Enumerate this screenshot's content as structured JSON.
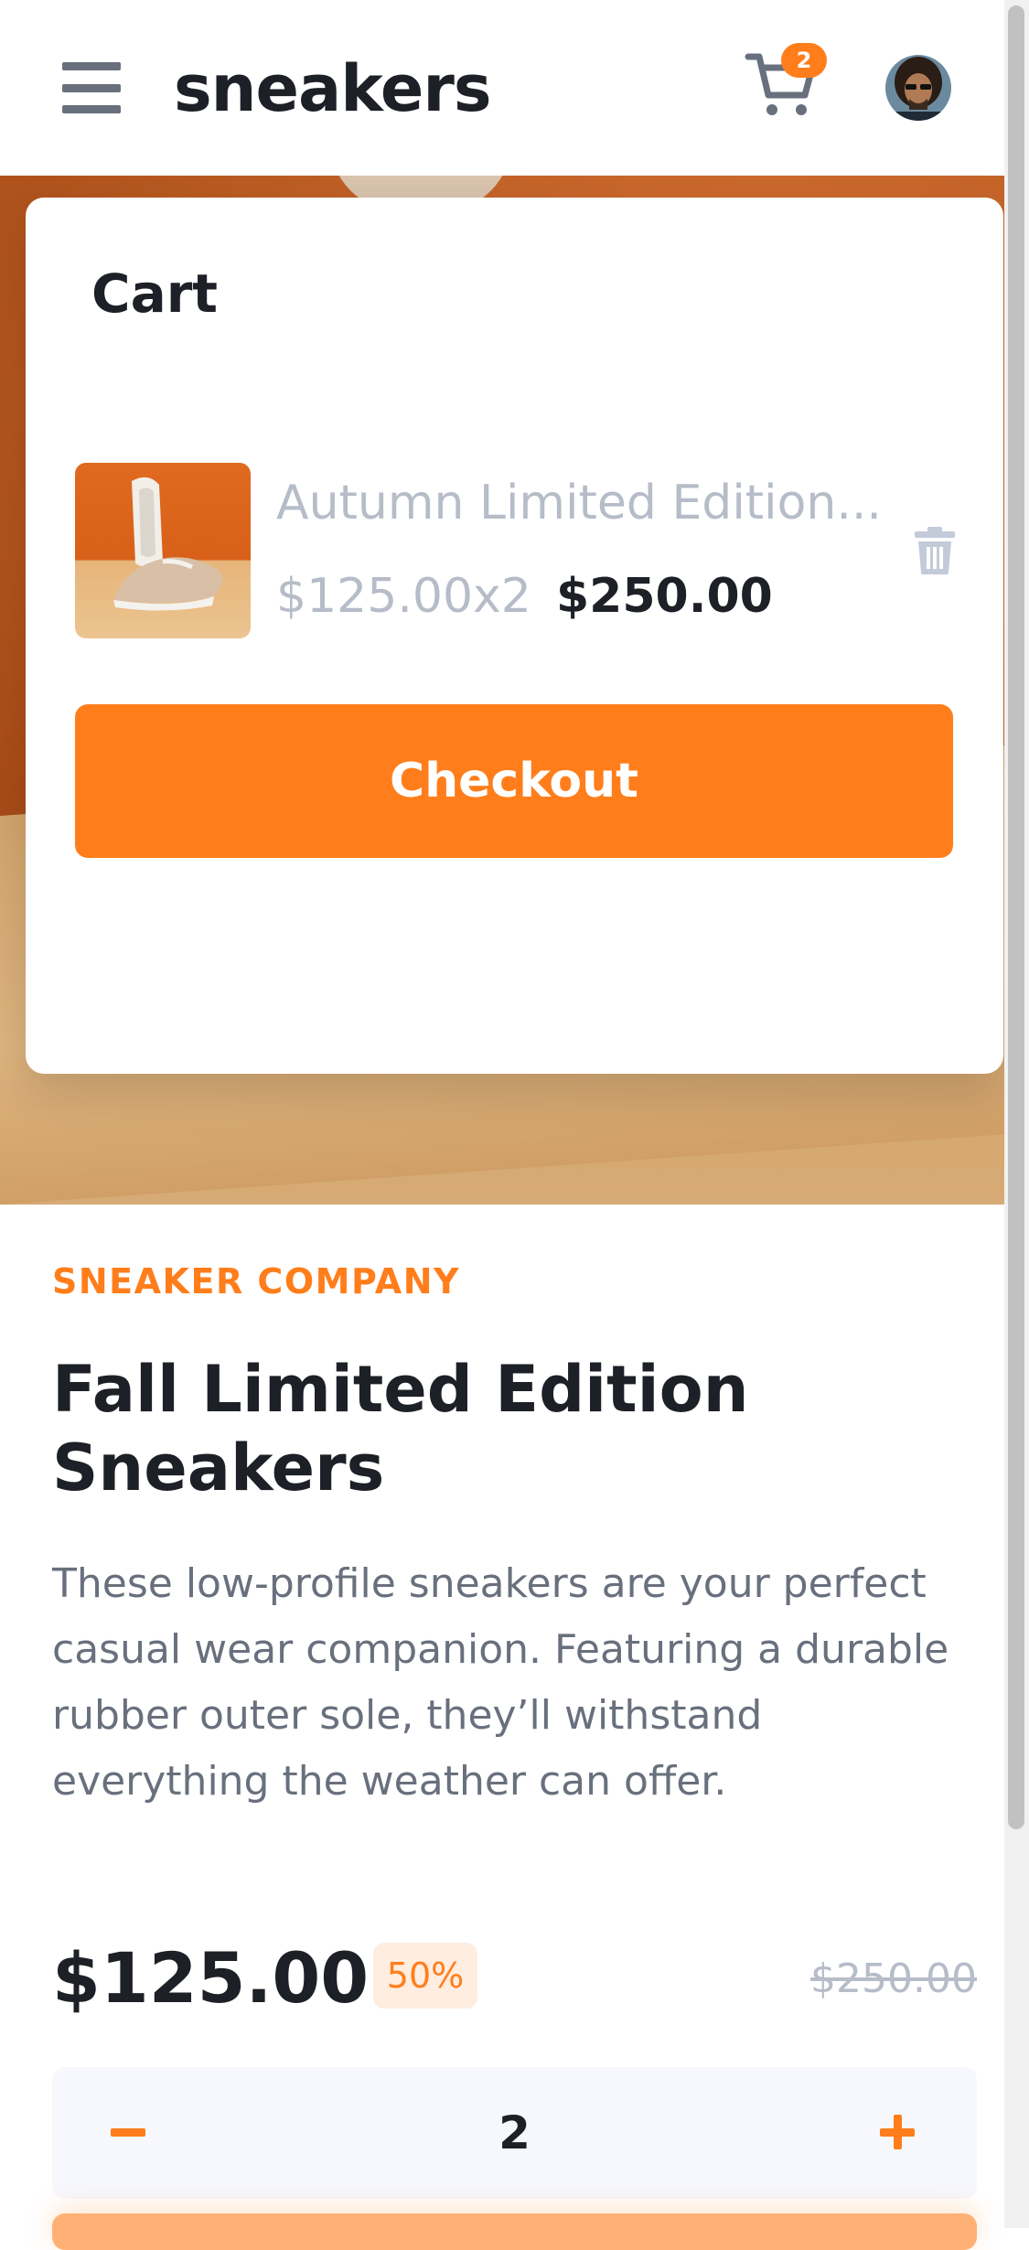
{
  "header": {
    "brand": "sneakers",
    "cart_count": "2"
  },
  "cart": {
    "title": "Cart",
    "item": {
      "name": "Autumn Limited Edition...",
      "unit_price": "$125.00x2",
      "total": "$250.00"
    },
    "checkout_label": "Checkout"
  },
  "product": {
    "company": "SNEAKER COMPANY",
    "title": "Fall Limited Edition Sneakers",
    "description": "These low-profile sneakers are your perfect casual wear companion. Featuring a durable rubber outer sole, they’ll withstand everything the weather can offer.",
    "price": "$125.00",
    "discount": "50%",
    "old_price": "$250.00",
    "quantity": "2"
  },
  "colors": {
    "accent": "#ff7e1b",
    "accent_pale": "#ffede0",
    "dark": "#1d2026",
    "muted": "#69707d",
    "light_muted": "#b6bcc8",
    "qty_bg": "#f6f8fd"
  },
  "icons": {
    "menu": "menu-icon",
    "cart": "cart-icon",
    "delete": "trash-icon",
    "minus": "minus-icon",
    "plus": "plus-icon"
  }
}
